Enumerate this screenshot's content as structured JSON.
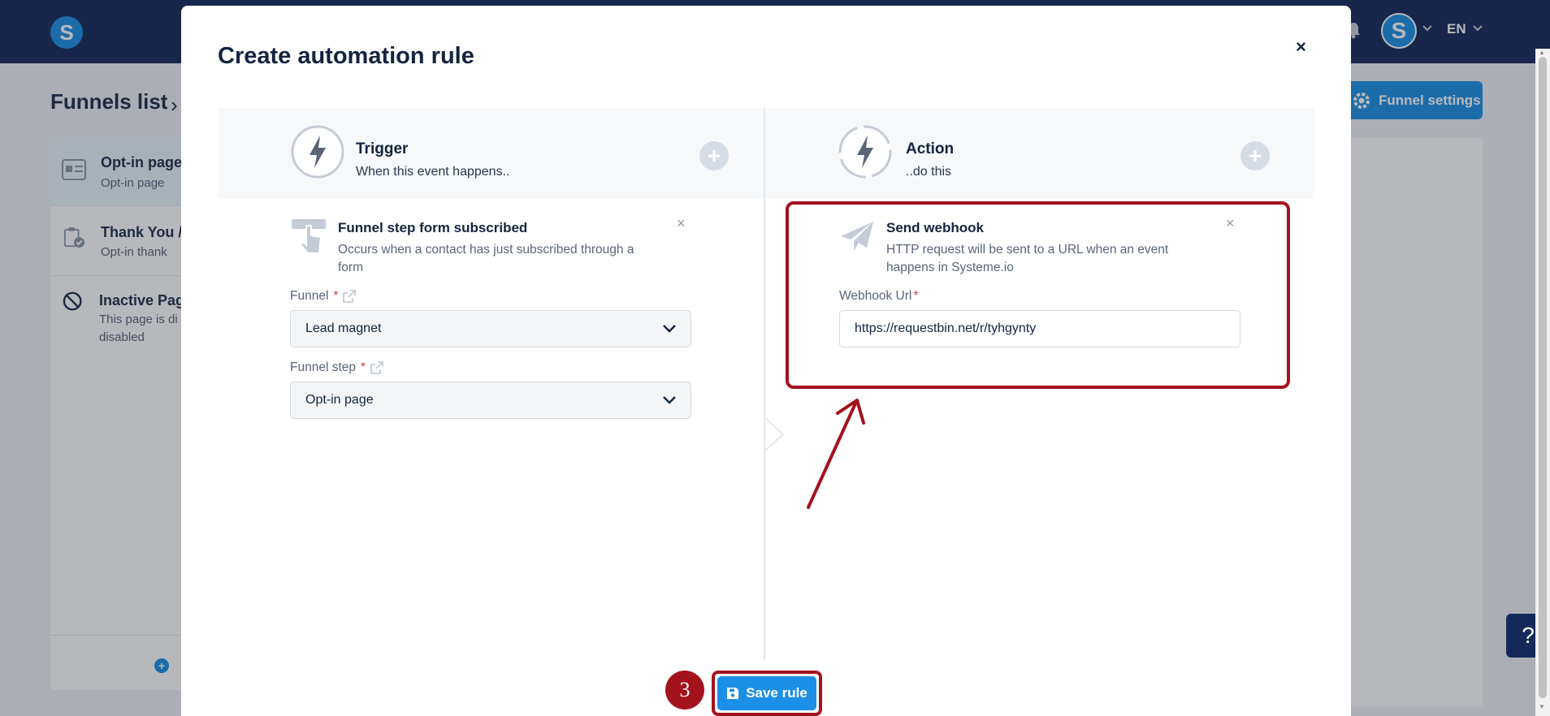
{
  "app": {
    "logo_letter": "S",
    "avatar_letter": "S",
    "language": "EN"
  },
  "background": {
    "page_title": "Funnels list",
    "settings_button": "Funnel settings",
    "steps": [
      {
        "title": "Opt-in page",
        "subtitle": "Opt-in page"
      },
      {
        "title": "Thank You /",
        "subtitle": "Opt-in thank"
      },
      {
        "title": "Inactive Pag",
        "subtitle": "This page is di",
        "subtitle2": "disabled"
      }
    ],
    "help_label": "?"
  },
  "modal": {
    "title": "Create automation rule",
    "close_label": "×",
    "trigger": {
      "title": "Trigger",
      "subtitle": "When this event happens.."
    },
    "action": {
      "title": "Action",
      "subtitle": "..do this"
    },
    "trigger_card": {
      "title": "Funnel step form subscribed",
      "desc_line1": "Occurs when a contact has just subscribed through a",
      "desc_line2": "form",
      "funnel_label": "Funnel",
      "funnel_value": "Lead magnet",
      "step_label": "Funnel step",
      "step_value": "Opt-in page"
    },
    "action_card": {
      "title": "Send webhook",
      "desc_line1": "HTTP request will be sent to a URL when an event",
      "desc_line2": "happens in Systeme.io",
      "url_label": "Webhook Url",
      "url_value": "https://requestbin.net/r/tyhgynty"
    },
    "required_mark": "*",
    "remove_label": "×",
    "step_number": "3",
    "save_button": "Save rule"
  },
  "colors": {
    "navy": "#14295a",
    "primary": "#1b8fe6",
    "annotation_red": "#a3121d"
  }
}
